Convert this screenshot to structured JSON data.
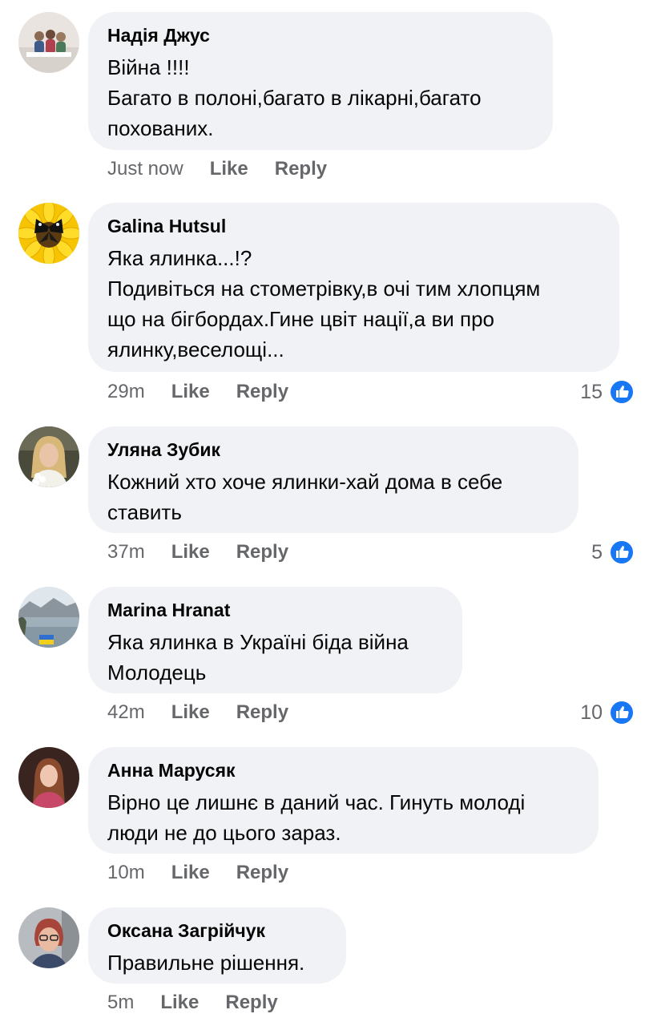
{
  "colors": {
    "bubble": "#f0f2f5",
    "meta_text": "#65676b",
    "like_blue": "#1877f2"
  },
  "comments": [
    {
      "author": "Надія Джус",
      "text": "Війна !!!!\nБагато в полоні,багато в лікарні,багато\nпохованих.",
      "time": "Just now",
      "like_label": "Like",
      "reply_label": "Reply",
      "reaction_count": "",
      "avatar_icon": "family-photo-avatar"
    },
    {
      "author": "Galina Hutsul",
      "text": "Яка ялинка...!?\nПодивіться на стометрівку,в очі тим хлопцям\nщо на бігбордах.Гине цвіт нації,а ви про\nялинку,веселощі...",
      "time": "29m",
      "like_label": "Like",
      "reply_label": "Reply",
      "reaction_count": "15",
      "avatar_icon": "sunflower-butterfly-avatar"
    },
    {
      "author": "Уляна Зубик",
      "text": "Кожний хто хоче ялинки-хай дома в себе\nставить",
      "time": "37m",
      "like_label": "Like",
      "reply_label": "Reply",
      "reaction_count": "5",
      "avatar_icon": "woman-portrait-avatar"
    },
    {
      "author": "Marina Hranat",
      "text": "Яка ялинка в Україні біда війна\nМолодець",
      "time": "42m",
      "like_label": "Like",
      "reply_label": "Reply",
      "reaction_count": "10",
      "avatar_icon": "lake-landscape-avatar"
    },
    {
      "author": "Анна Марусяк",
      "text": "Вірно це лишнє в даний час. Гинуть молоді\nлюди не до цього зараз.",
      "time": "10m",
      "like_label": "Like",
      "reply_label": "Reply",
      "reaction_count": "",
      "avatar_icon": "girl-portrait-avatar"
    },
    {
      "author": "Оксана Загрійчук",
      "text": "Правильне рішення.",
      "time": "5m",
      "like_label": "Like",
      "reply_label": "Reply",
      "reaction_count": "",
      "avatar_icon": "woman-glasses-avatar"
    }
  ]
}
